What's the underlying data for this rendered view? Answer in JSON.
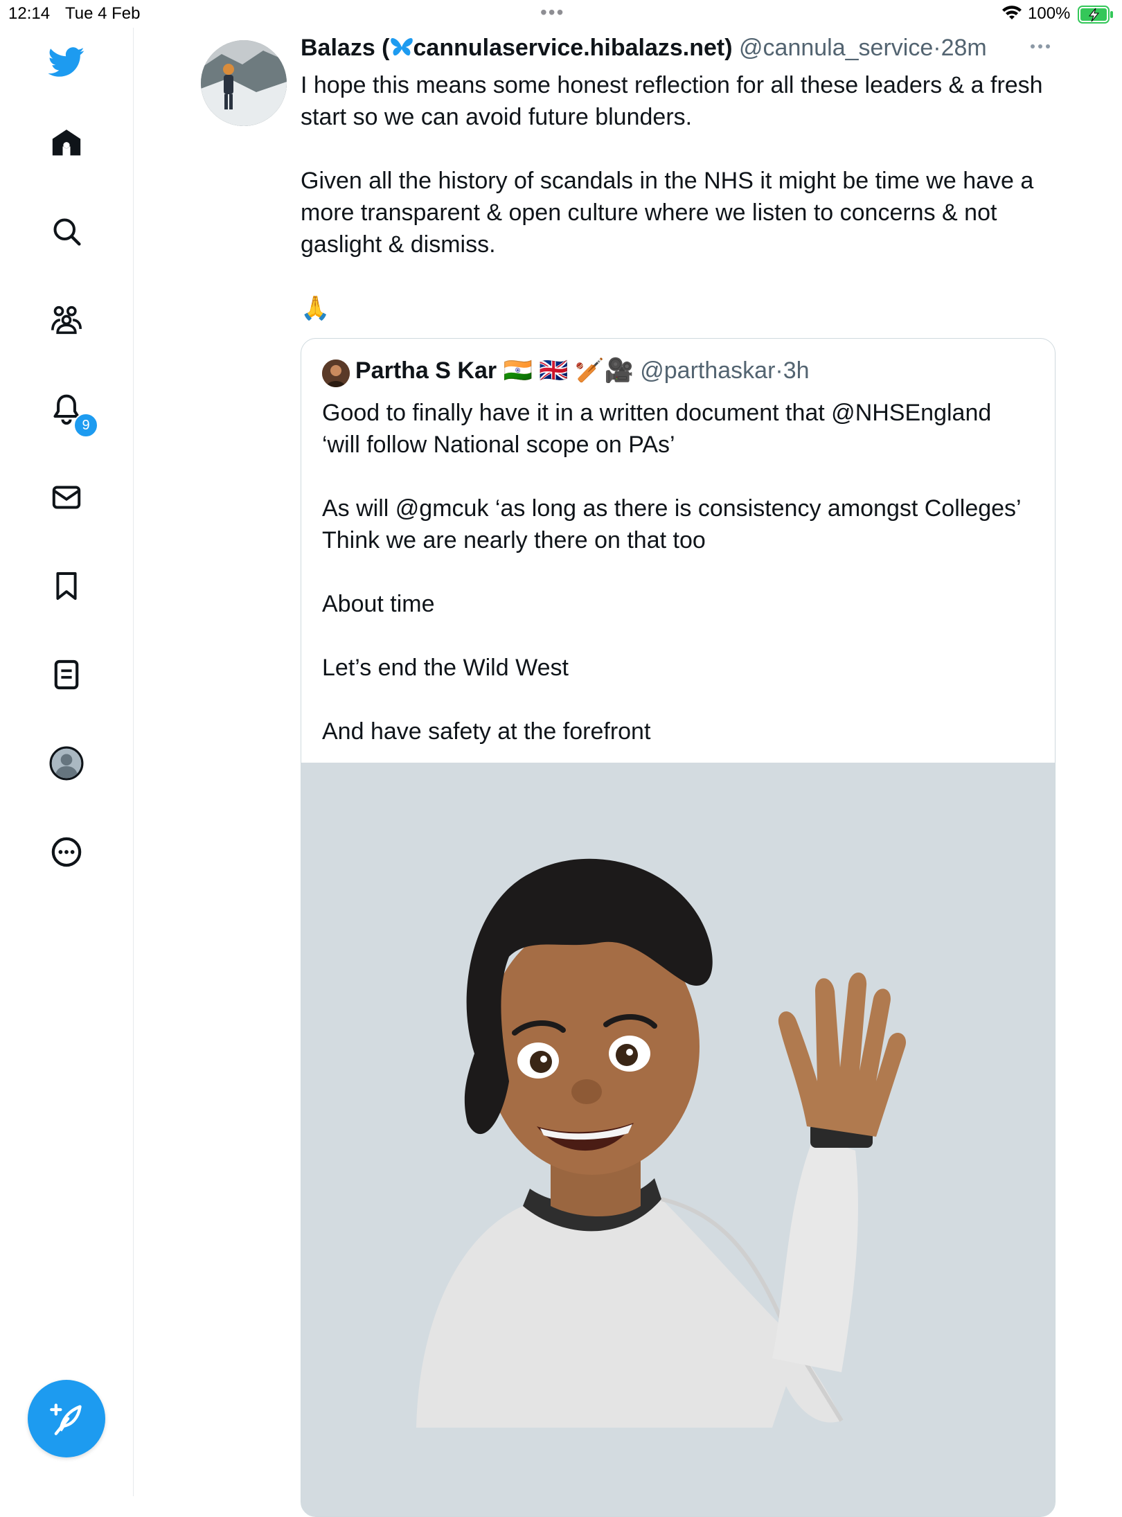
{
  "status_bar": {
    "time": "12:14",
    "date": "Tue 4 Feb",
    "battery": "100%"
  },
  "sidebar": {
    "items": [
      {
        "name": "twitter-logo",
        "icon": "twitter-bird-icon"
      },
      {
        "name": "home",
        "icon": "home-icon"
      },
      {
        "name": "explore",
        "icon": "search-icon"
      },
      {
        "name": "communities",
        "icon": "communities-icon"
      },
      {
        "name": "notifications",
        "icon": "bell-icon",
        "badge": "9"
      },
      {
        "name": "messages",
        "icon": "envelope-icon"
      },
      {
        "name": "bookmarks",
        "icon": "bookmark-icon"
      },
      {
        "name": "lists",
        "icon": "list-icon"
      },
      {
        "name": "profile",
        "icon": "profile-avatar-icon"
      },
      {
        "name": "more",
        "icon": "more-circle-icon"
      }
    ],
    "compose_icon": "compose-feather-icon"
  },
  "tweet": {
    "author_name_prefix": "Balazs (",
    "author_name_suffix": "cannulaservice.hibalazs.net)",
    "name_emoji_icon": "butterfly-icon",
    "handle": "@cannula_service",
    "separator": "·",
    "time": "28m",
    "text": "I hope this means some honest reflection for all these leaders & a fresh start so we can avoid future blunders.\n\nGiven all the history of scandals in the NHS it might be time we have a more transparent & open culture where we listen to concerns & not gaslight & dismiss.\n\n🙏",
    "quoted": {
      "author_name": "Partha S Kar",
      "name_emojis": "🇮🇳 🇬🇧 🏏🎥",
      "handle": "@parthaskar",
      "separator": "·",
      "time": "3h",
      "text": "Good to finally have it in a written document that @NHSEngland ‘will follow National scope on PAs’\n\nAs will @gmcuk ‘as long as there is consistency amongst Colleges’\nThink we are nearly there on that too\n\nAbout time\n\nLet’s end the Wild West\n\nAnd have safety at the forefront",
      "media": "memoji-waving-image"
    }
  },
  "colors": {
    "accent": "#1d9bf0",
    "text": "#0f1419",
    "secondary": "#536471",
    "border": "#cfd9de",
    "media_bg": "#d3dbe0"
  }
}
